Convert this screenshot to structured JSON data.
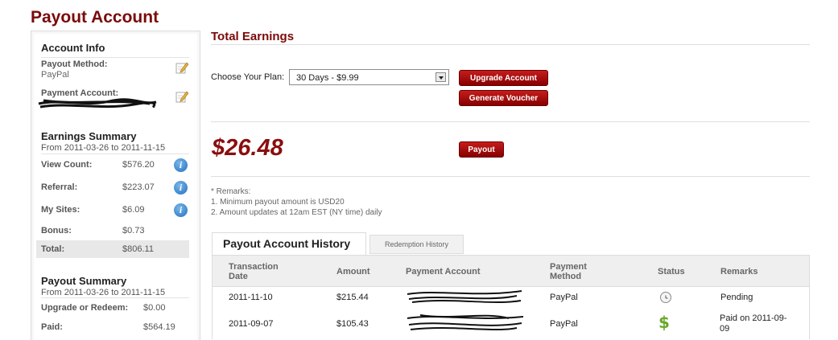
{
  "page_title": "Payout Account",
  "sidebar": {
    "account_info": {
      "heading": "Account Info",
      "payout_method_label": "Payout Method:",
      "payout_method_value": "PayPal",
      "payment_account_label": "Payment Account:"
    },
    "earnings_summary": {
      "heading": "Earnings Summary",
      "range": "From 2011-03-26 to 2011-11-15",
      "rows": [
        {
          "label": "View Count:",
          "value": "$576.20"
        },
        {
          "label": "Referral:",
          "value": "$223.07"
        },
        {
          "label": "My Sites:",
          "value": "$6.09"
        },
        {
          "label": "Bonus:",
          "value": "$0.73"
        },
        {
          "label": "Total:",
          "value": "$806.11"
        }
      ]
    },
    "payout_summary": {
      "heading": "Payout Summary",
      "range": "From 2011-03-26 to 2011-11-15",
      "rows": [
        {
          "label": "Upgrade or Redeem:",
          "value": "$0.00"
        },
        {
          "label": "Paid:",
          "value": "$564.19"
        }
      ]
    }
  },
  "main": {
    "title": "Total Earnings",
    "plan_label": "Choose Your Plan:",
    "plan_selected": "30 Days - $9.99",
    "upgrade_button": "Upgrade Account",
    "voucher_button": "Generate Voucher",
    "amount": "$26.48",
    "payout_button": "Payout",
    "remarks": [
      "* Remarks:",
      "1. Minimum payout amount is USD20",
      "2. Amount updates at 12am EST (NY time) daily"
    ]
  },
  "tabs": {
    "active": "Payout Account History",
    "inactive": "Redemption History"
  },
  "table": {
    "headers": {
      "date_line1": "Transaction",
      "date_line2": "Date",
      "amount": "Amount",
      "account": "Payment Account",
      "method_line1": "Payment",
      "method_line2": "Method",
      "status": "Status",
      "remarks": "Remarks"
    },
    "rows": [
      {
        "date": "2011-11-10",
        "amount": "$215.44",
        "method": "PayPal",
        "status_icon": "clock-icon",
        "remarks": "Pending",
        "remarks_line2": ""
      },
      {
        "date": "2011-09-07",
        "amount": "$105.43",
        "method": "PayPal",
        "status_icon": "dollar-icon",
        "remarks": "Paid on 2011-09-",
        "remarks_line2": "09"
      }
    ]
  },
  "colors": {
    "accent": "#7a0a0a",
    "button": "#a50f0f",
    "paid_icon": "#6aa82a"
  }
}
